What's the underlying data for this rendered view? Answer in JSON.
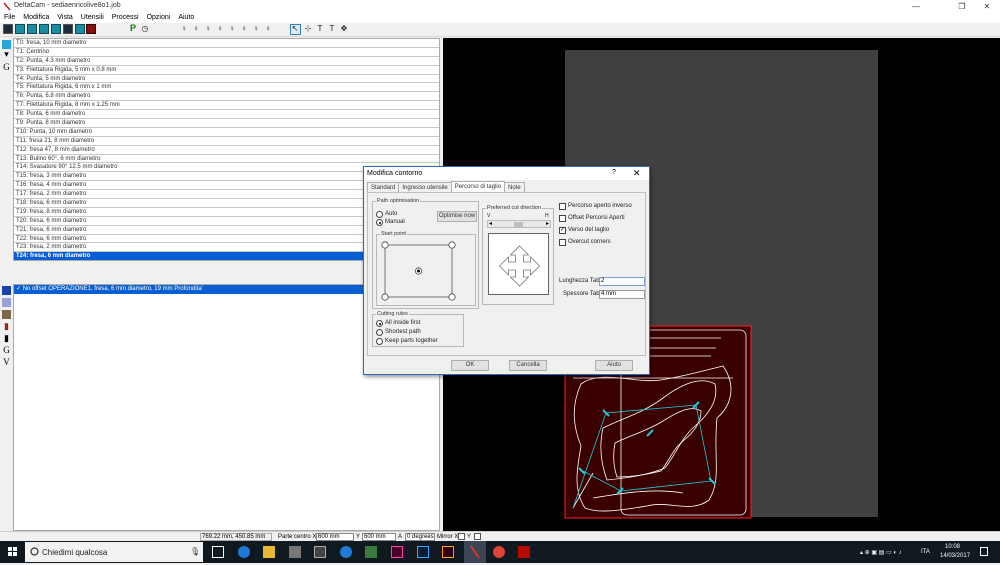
{
  "window": {
    "title": "DeltaCam - sediaenricolive8o1.job",
    "minimize": "—",
    "restore": "❐",
    "close": "✕"
  },
  "menu": [
    "File",
    "Modifica",
    "Vista",
    "Utensili",
    "Processi",
    "Opzioni",
    "Aiuto"
  ],
  "toolbar": {
    "p_label": "P"
  },
  "left_strip_letters": {
    "g1": "G",
    "g2": "G",
    "v": "V"
  },
  "tools": [
    "T0: fresa, 10 mm diametro",
    "T1: Centrino",
    "T2: Punta, 4.3 mm diametro",
    "T3: Filettatura Rigida, 5 mm x 0.8 mm",
    "T4: Punta, 5 mm diametro",
    "T5: Filettatura Rigida, 6 mm x 1 mm",
    "T6: Punta, 6.8 mm diametro",
    "T7: Filettatura Rigida, 8 mm x 1.25 mm",
    "T8: Punta, 6 mm diametro",
    "T9: Punta, 8 mm diametro",
    "T10: Punta, 10 mm diametro",
    "T11: fresa 21, 8 mm diametro",
    "T12: fresa 47, 8 mm diametro",
    "T13: Bulino 60°, 6 mm diametro",
    "T14: Svasatore 90° 12.5 mm diametro",
    "T15: fresa, 3 mm diametro",
    "T16: fresa, 4 mm diametro",
    "T17: fresa, 2 mm diametro",
    "T18: fresa, 6 mm diametro",
    "T19: fresa, 8 mm diametro",
    "T20: fresa, 6 mm diametro",
    "T21: fresa, 6 mm diametro",
    "T22: fresa, 6 mm diametro",
    "T23: fresa, 2 mm diametro",
    "T24: fresa, 6 mm diametro"
  ],
  "selected_tool_index": 24,
  "operations": [
    "No offset OPERAZIONE1, fresa, 6 mm diametro, 19 mm Profondita'"
  ],
  "operation_check": "✓",
  "dialog": {
    "title": "Modifica contorno",
    "help": "?",
    "close": "✕",
    "tabs": [
      "Standard",
      "Ingresso utensile",
      "Percorso di taglio",
      "Note"
    ],
    "active_tab": 2,
    "path_optimisation": {
      "title": "Path optimisation",
      "auto": "Auto",
      "manual": "Manual",
      "optimise_button": "Optimise now",
      "selected": "Manual"
    },
    "start_point": {
      "title": "Start point"
    },
    "preferred_cut": {
      "title": "Preferred cut direction",
      "v": "V",
      "h": "H",
      "left_arrow": "◂",
      "right_arrow": "▸"
    },
    "cutting_rules": {
      "title": "Cutting rules",
      "options": [
        "All inside first",
        "Shortest path",
        "Keep parts together"
      ],
      "selected": "All inside first"
    },
    "options": [
      {
        "label": "Percorso aperto inverso",
        "checked": false
      },
      {
        "label": "Offset Percorsi Aperti",
        "checked": false
      },
      {
        "label": "Verso del taglio",
        "checked": true
      },
      {
        "label": "Overcut corners",
        "checked": false
      }
    ],
    "tab_length": {
      "label": "Lunghezza Tab",
      "value": "2"
    },
    "tab_thickness": {
      "label": "Spessore Tab",
      "value": "4 mm"
    },
    "buttons": {
      "ok": "OK",
      "cancel": "Cancella",
      "help": "Aiuto"
    }
  },
  "status": {
    "coords": "769.22 mm, 450.85 mm",
    "part_center_label": "Parte centro X",
    "x_value": "600 mm",
    "y_label": "Y",
    "y_value": "600 mm",
    "a_label": "A",
    "a_value": "0 degrees",
    "mirror_label": "Mirror X",
    "mirror_y_label": "Y"
  },
  "taskbar": {
    "search_placeholder": "Chiedimi qualcosa",
    "language": "ITA",
    "time": "10:08",
    "date": "14/03/2017"
  },
  "colors": {
    "selection": "#0a5fd0",
    "cad_outline": "#ffffff",
    "cad_toolpath": "#22c8d8",
    "cad_part": "#3a0000",
    "cad_border": "#ff2020"
  }
}
